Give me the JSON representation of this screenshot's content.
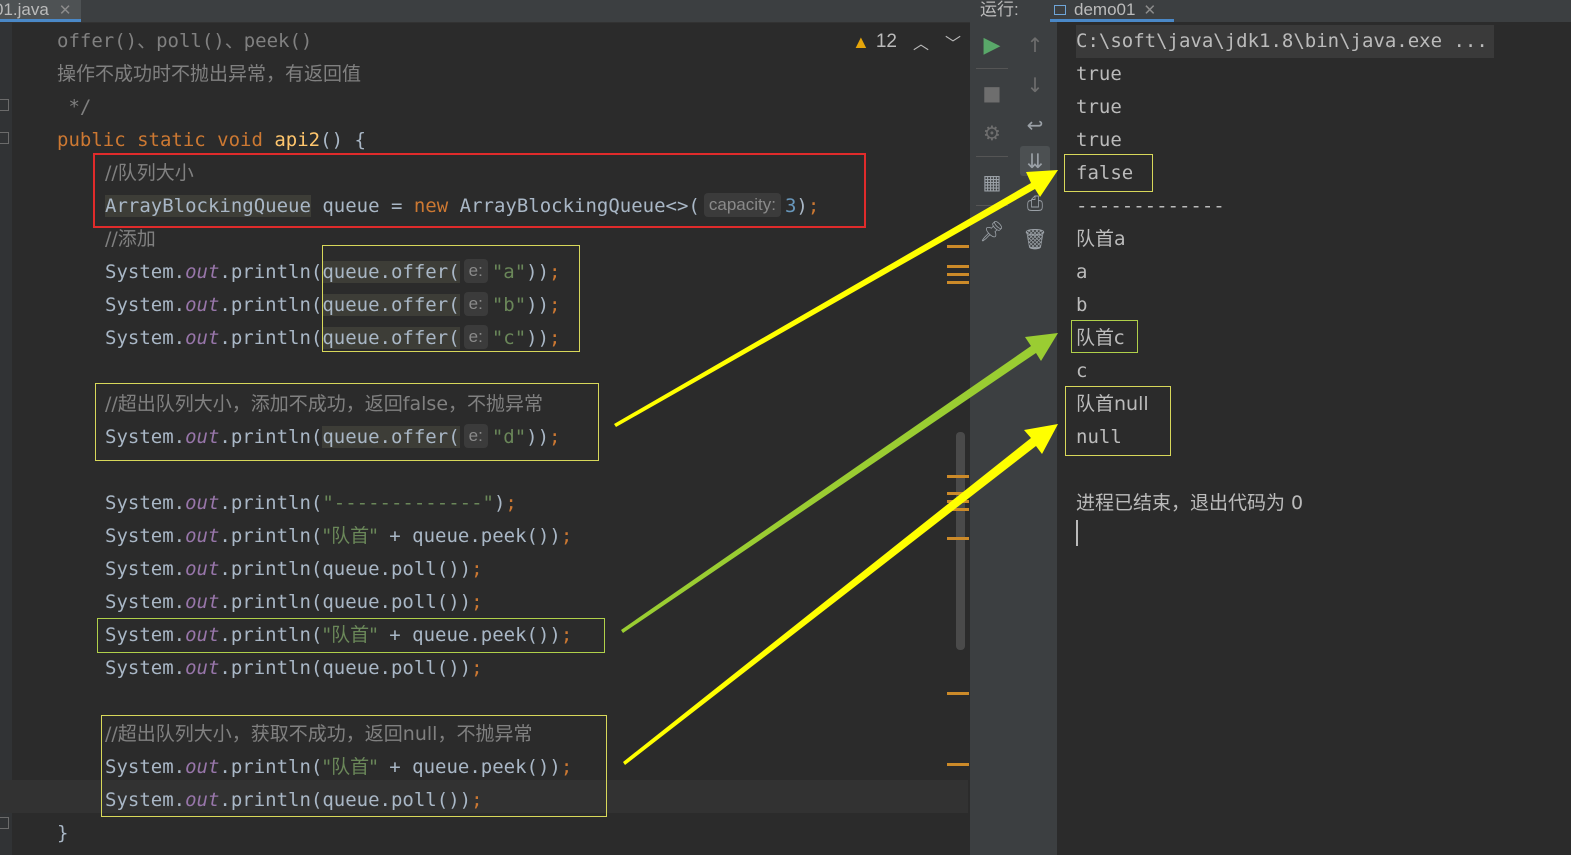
{
  "editor": {
    "tab_label": "01.java",
    "inspection_count": "12",
    "lines": {
      "l1": "offer()、poll()、peek()",
      "l2": "操作不成功时不抛出异常，有返回值",
      "l3": " */",
      "l4_kw": "public static void",
      "l4_fn": "api2",
      "l4_rest": "() {",
      "l5": "//队列大小",
      "l6_type": "ArrayBlockingQueue",
      "l6_a": " queue = ",
      "l6_new": "new",
      "l6_b": " ArrayBlockingQueue<>(",
      "l6_hint": "capacity:",
      "l6_num": "3",
      "l7": "//添加",
      "sys": "System.",
      "out": "out",
      "println_open": ".println(",
      "offer": "queue.offer(",
      "hint_e": "e:",
      "str_a": "\"a\"",
      "str_b": "\"b\"",
      "str_c": "\"c\"",
      "str_d": "\"d\"",
      "close2": "))",
      "close1": ")",
      "semi": ";",
      "l11": "//超出队列大小，添加不成功，返回false，不抛异常",
      "str_dash": "\"-------------\"",
      "str_head": "\"队首\"",
      "peek_tail": " + queue.peek())",
      "poll_tail": "queue.poll())",
      "l22": "//超出队列大小，获取不成功，返回null，不抛异常",
      "close_brace": "}"
    }
  },
  "run": {
    "label": "运行:",
    "tab_label": "demo01",
    "console": [
      "C:\\soft\\java\\jdk1.8\\bin\\java.exe ...",
      "true",
      "true",
      "true",
      "false",
      "-------------",
      "队首a",
      "a",
      "b",
      "队首c",
      "c",
      "队首null",
      "null",
      "",
      "进程已结束，退出代码为 0"
    ]
  },
  "icons": {
    "warning": "warning-icon",
    "run": "run-icon",
    "stop": "stop-icon",
    "rerun": "rerun-icon",
    "layout": "layout-icon",
    "pin": "pin-icon",
    "up": "arrow-up-icon",
    "down": "arrow-down-icon",
    "wrap": "soft-wrap-icon",
    "scroll_end": "scroll-to-end-icon",
    "print": "print-icon",
    "trash": "trash-icon"
  },
  "colors": {
    "keyword": "#cc7832",
    "string": "#6a8759",
    "comment": "#808080",
    "number": "#6897bb",
    "field": "#9876aa",
    "method": "#ffc66d",
    "red_box": "#e02b2b",
    "yellow_arrow": "#ffff00",
    "green_arrow": "#9acd32"
  }
}
